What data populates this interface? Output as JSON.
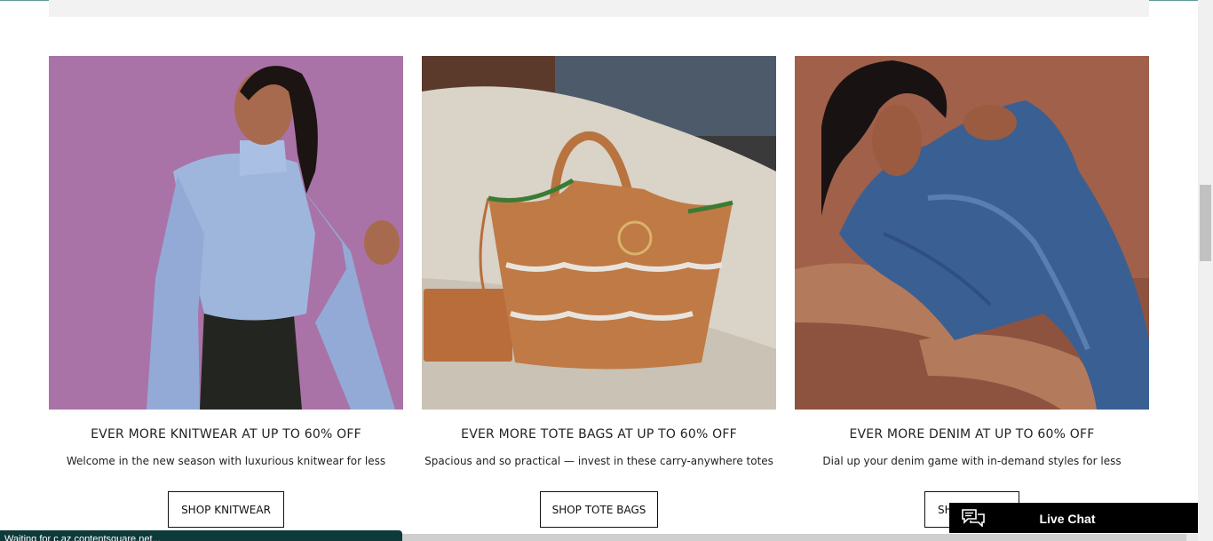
{
  "cards": [
    {
      "title": "EVER MORE KNITWEAR AT UP TO 60% OFF",
      "subtitle": "Welcome in the new season with luxurious knitwear for less",
      "button": "SHOP KNITWEAR",
      "image": "model-in-light-blue-knit-sweater"
    },
    {
      "title": "EVER MORE TOTE BAGS AT UP TO 60% OFF",
      "subtitle": "Spacious and so practical — invest in these carry-anywhere totes",
      "button": "SHOP TOTE BAGS",
      "image": "tan-leather-tote-bag-on-sofa"
    },
    {
      "title": "EVER MORE DENIM AT UP TO 60% OFF",
      "subtitle": "Dial up your denim game with in-demand styles for less",
      "button": "SH",
      "image": "model-in-denim-jacket"
    }
  ],
  "live_chat": {
    "label": "Live Chat",
    "icon": "chat-bubbles-icon"
  },
  "status_bar": {
    "text": "Waiting for c.az.contentsquare.net..."
  },
  "colors": {
    "accent_line": "#5f9c98",
    "status_bar_bg": "#0f3a3a",
    "live_chat_bg": "#000000"
  }
}
